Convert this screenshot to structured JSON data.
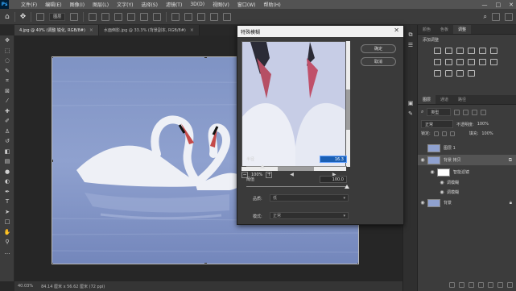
{
  "app": {
    "logo": "Ps",
    "menu": [
      "文件(F)",
      "编辑(E)",
      "图像(I)",
      "图层(L)",
      "文字(Y)",
      "选择(S)",
      "滤镜(T)",
      "3D(D)",
      "视图(V)",
      "窗口(W)",
      "帮助(H)"
    ],
    "window_controls": [
      "—",
      "□",
      "✕"
    ]
  },
  "options_bar": {
    "align_select": "图层"
  },
  "tabs": [
    {
      "label": "4.jpg @ 40% (调整 锐化, RGB/8#)",
      "active": true
    },
    {
      "label": "水面倒影.jpg @ 33.3% (背景副本, RGB/8#)",
      "active": false
    }
  ],
  "status": {
    "zoom": "40.03%",
    "doc_info": "84.14 厘米 x 56.62 厘米 (72 ppi)"
  },
  "dialog": {
    "title": "特殊模糊",
    "close": "✕",
    "ok": "确定",
    "cancel": "取消",
    "zoom": "100%",
    "minus": "−",
    "plus": "+",
    "radius_label": "半径",
    "radius_value": "16.3",
    "threshold_label": "阈值",
    "threshold_value": "100.0",
    "quality_label": "品质:",
    "quality_value": "低",
    "mode_label": "模式:",
    "mode_value": "正常",
    "radius_position": 0.16,
    "threshold_position": 1.0
  },
  "panels": {
    "top_tabs": [
      "颜色",
      "色板",
      "调整"
    ],
    "adjust_title": "添加调整",
    "layer_tabs": [
      "图层",
      "通道",
      "路径"
    ],
    "filter_kind": "类型",
    "blend_mode": "正常",
    "opacity_label": "不透明度:",
    "opacity_value": "100%",
    "lock_label": "锁定:",
    "fill_label": "填充:",
    "fill_value": "100%",
    "layers": [
      {
        "name": "图层 1",
        "eye": ""
      },
      {
        "name": "背景 拷贝",
        "eye": "◉"
      },
      {
        "name": "智能滤镜",
        "eye": "◉"
      },
      {
        "name": "调模糊",
        "eye": "◉"
      },
      {
        "name": "调模糊",
        "eye": "◉"
      },
      {
        "name": "背景",
        "eye": "◉"
      }
    ]
  }
}
